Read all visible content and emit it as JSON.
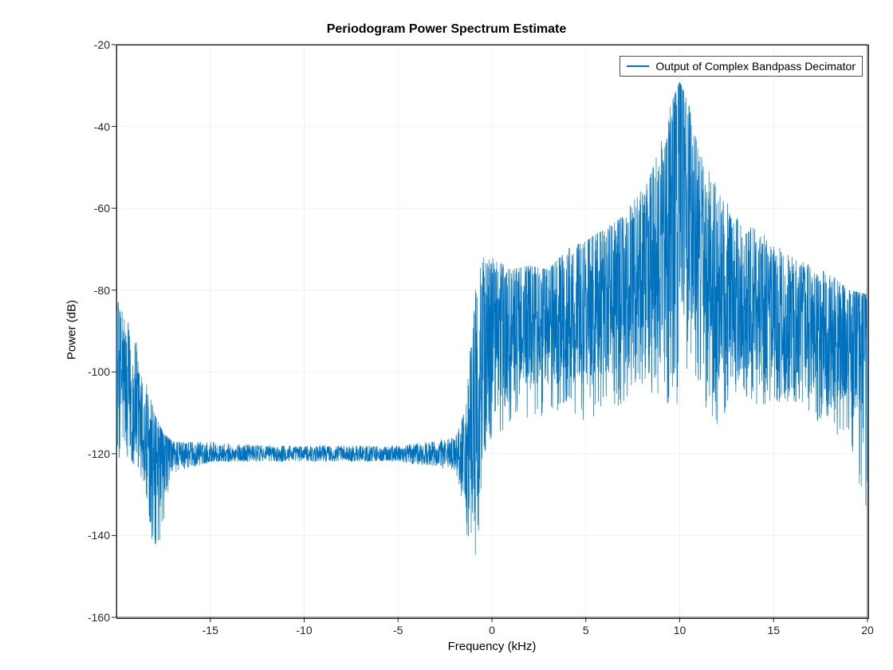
{
  "chart_data": {
    "type": "line",
    "title": "Periodogram Power Spectrum Estimate",
    "xlabel": "Frequency (kHz)",
    "ylabel": "Power (dB)",
    "xlim": [
      -20,
      20
    ],
    "ylim": [
      -160,
      -20
    ],
    "xticks": [
      -15,
      -10,
      -5,
      0,
      5,
      10,
      15,
      20
    ],
    "yticks": [
      -160,
      -140,
      -120,
      -100,
      -80,
      -60,
      -40,
      -20
    ],
    "grid": true,
    "legend_position": "top-right",
    "series": [
      {
        "name": "Output of Complex Bandpass Decimator",
        "color": "#0072bd",
        "x": [
          -20,
          -19,
          -18.5,
          -18,
          -17.5,
          -17,
          -15,
          -12,
          -10,
          -8,
          -5,
          -2,
          -1.5,
          -1,
          -0.5,
          0,
          1,
          2,
          3,
          4,
          5,
          6,
          7,
          8,
          9,
          9.5,
          10,
          10.5,
          11,
          12,
          13,
          14,
          15,
          16,
          17,
          18,
          19,
          20
        ],
        "upper": [
          -81,
          -90,
          -100,
          -110,
          -115,
          -117,
          -117,
          -118,
          -118,
          -118,
          -118,
          -116,
          -110,
          -82,
          -72,
          -72,
          -75,
          -74,
          -75,
          -70,
          -68,
          -65,
          -62,
          -55,
          -44,
          -35,
          -29,
          -35,
          -46,
          -55,
          -62,
          -65,
          -68,
          -72,
          -74,
          -76,
          -80,
          -81
        ],
        "lower": [
          -122,
          -124,
          -128,
          -146,
          -138,
          -125,
          -122,
          -122,
          -122,
          -122,
          -122,
          -124,
          -135,
          -154,
          -128,
          -118,
          -115,
          -112,
          -112,
          -110,
          -112,
          -110,
          -108,
          -104,
          -108,
          -108,
          -108,
          -108,
          -105,
          -115,
          -105,
          -108,
          -108,
          -108,
          -112,
          -114,
          -118,
          -135
        ],
        "mean": [
          -100,
          -108,
          -116,
          -122,
          -121,
          -120,
          -120,
          -120,
          -120,
          -120,
          -120,
          -120,
          -120,
          -118,
          -95,
          -90,
          -90,
          -88,
          -88,
          -86,
          -84,
          -82,
          -80,
          -76,
          -72,
          -62,
          -45,
          -62,
          -72,
          -80,
          -82,
          -84,
          -86,
          -88,
          -90,
          -92,
          -94,
          -95
        ]
      }
    ],
    "notes": "Noisy periodogram. 'upper'/'lower' give approximate envelope of the spectral noise; 'mean' is the approximate central trend in dB. Strong narrowband peak near 10 kHz reaching about -29 dB. Noise floor of roughly -120 dB over negative frequencies, rising to a broadband hump centered at ~10 kHz with shoulders around -85 dB."
  }
}
